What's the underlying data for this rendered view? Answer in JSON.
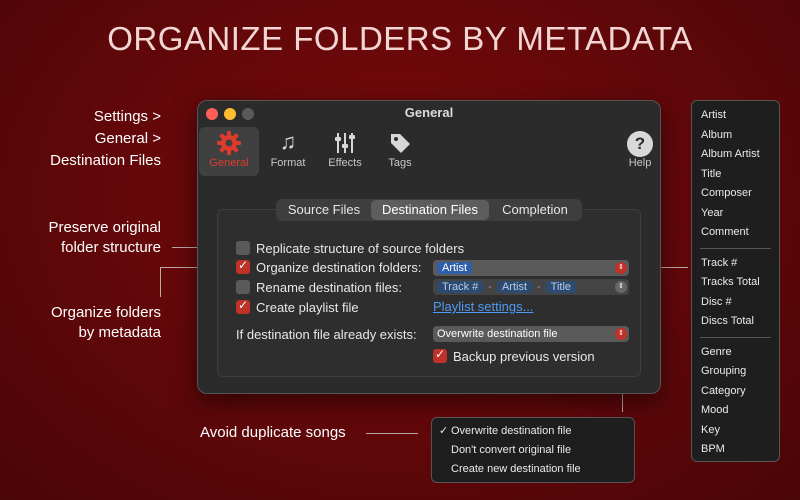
{
  "headline": "ORGANIZE FOLDERS BY METADATA",
  "annotations": {
    "settings_path": [
      "Settings >",
      "General >",
      "Destination Files"
    ],
    "preserve": [
      "Preserve original",
      "folder structure"
    ],
    "organize": [
      "Organize folders",
      "by metadata"
    ],
    "duplicates": "Avoid duplicate songs"
  },
  "window": {
    "title": "General",
    "toolbar": [
      {
        "label": "General",
        "icon": "gear-icon",
        "active": true
      },
      {
        "label": "Format",
        "icon": "music-note-icon"
      },
      {
        "label": "Effects",
        "icon": "sliders-icon"
      },
      {
        "label": "Tags",
        "icon": "tag-icon"
      },
      {
        "label": "Help",
        "icon": "help-icon"
      }
    ],
    "tabs": [
      "Source Files",
      "Destination Files",
      "Completion"
    ],
    "active_tab": "Destination Files",
    "options": {
      "replicate": {
        "label": "Replicate structure of source folders",
        "checked": false
      },
      "organize": {
        "label": "Organize destination folders:",
        "checked": true,
        "value": "Artist"
      },
      "rename": {
        "label": "Rename destination files:",
        "checked": false,
        "tokens": [
          "Track #",
          "Artist",
          "Title"
        ],
        "separator": "-"
      },
      "playlist": {
        "label": "Create playlist file",
        "checked": true,
        "link": "Playlist settings..."
      },
      "exists": {
        "label": "If destination file already exists:",
        "value": "Overwrite destination file"
      },
      "backup": {
        "label": "Backup previous version",
        "checked": true
      }
    }
  },
  "exists_menu": {
    "selected": "Overwrite destination file",
    "items": [
      "Overwrite destination file",
      "Don't convert original file",
      "Create new destination file"
    ]
  },
  "tag_menu": {
    "groups": [
      [
        "Artist",
        "Album",
        "Album Artist",
        "Title",
        "Composer",
        "Year",
        "Comment"
      ],
      [
        "Track #",
        "Tracks Total",
        "Disc #",
        "Discs Total"
      ],
      [
        "Genre",
        "Grouping",
        "Category",
        "Mood",
        "Key",
        "BPM"
      ]
    ]
  },
  "colors": {
    "accent": "#e03a2c",
    "checkbox_on": "#c0312a",
    "link": "#4e9cf5",
    "token": "#2e5fa8",
    "background": "#5e0709"
  }
}
